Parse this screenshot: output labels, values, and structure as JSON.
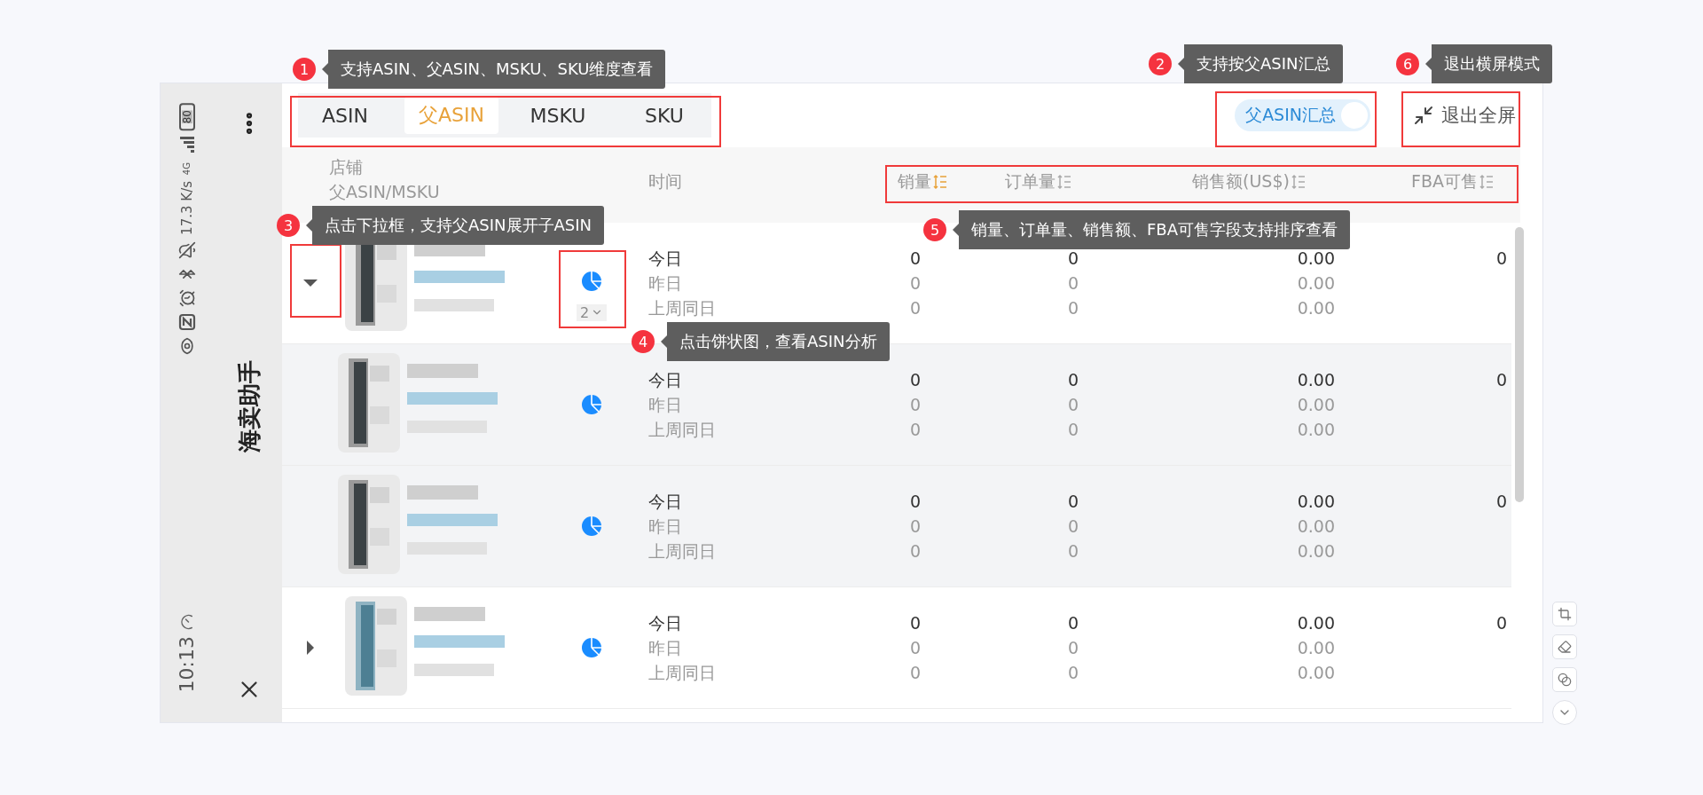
{
  "status_bar": {
    "battery": "80",
    "network": "4G",
    "speed": "17.3 K/s",
    "time": "10:13"
  },
  "app_bar": {
    "title": "海卖助手"
  },
  "tabs": [
    {
      "label": "ASIN",
      "selected": false
    },
    {
      "label": "父ASIN",
      "selected": true
    },
    {
      "label": "MSKU",
      "selected": false
    },
    {
      "label": "SKU",
      "selected": false
    }
  ],
  "summary_toggle": {
    "label": "父ASIN汇总",
    "on": true
  },
  "exit_button": {
    "label": "退出全屏"
  },
  "table": {
    "header": {
      "store": "店铺",
      "item": "父ASIN/MSKU",
      "time": "时间"
    },
    "sort_columns": [
      {
        "label": "销量",
        "selected": true
      },
      {
        "label": "订单量",
        "selected": false
      },
      {
        "label": "销售额(US$)",
        "selected": false
      },
      {
        "label": "FBA可售",
        "selected": false
      }
    ],
    "rows": [
      {
        "expanded": true,
        "child_count": "2",
        "fba": "0",
        "metrics": [
          {
            "period": "今日",
            "sales": "0",
            "orders": "0",
            "revenue": "0.00"
          },
          {
            "period": "昨日",
            "sales": "0",
            "orders": "0",
            "revenue": "0.00"
          },
          {
            "period": "上周同日",
            "sales": "0",
            "orders": "0",
            "revenue": "0.00"
          }
        ],
        "children": [
          {
            "fba": "0",
            "metrics": [
              {
                "period": "今日",
                "sales": "0",
                "orders": "0",
                "revenue": "0.00"
              },
              {
                "period": "昨日",
                "sales": "0",
                "orders": "0",
                "revenue": "0.00"
              },
              {
                "period": "上周同日",
                "sales": "0",
                "orders": "0",
                "revenue": "0.00"
              }
            ]
          },
          {
            "fba": "0",
            "metrics": [
              {
                "period": "今日",
                "sales": "0",
                "orders": "0",
                "revenue": "0.00"
              },
              {
                "period": "昨日",
                "sales": "0",
                "orders": "0",
                "revenue": "0.00"
              },
              {
                "period": "上周同日",
                "sales": "0",
                "orders": "0",
                "revenue": "0.00"
              }
            ]
          }
        ]
      },
      {
        "expanded": false,
        "fba": "0",
        "metrics": [
          {
            "period": "今日",
            "sales": "0",
            "orders": "0",
            "revenue": "0.00"
          },
          {
            "period": "昨日",
            "sales": "0",
            "orders": "0",
            "revenue": "0.00"
          },
          {
            "period": "上周同日",
            "sales": "0",
            "orders": "0",
            "revenue": "0.00"
          }
        ]
      }
    ]
  },
  "annotations": [
    {
      "number": "1",
      "text": "支持ASIN、父ASIN、MSKU、SKU维度查看"
    },
    {
      "number": "2",
      "text": "支持按父ASIN汇总"
    },
    {
      "number": "3",
      "text": "点击下拉框，支持父ASIN展开子ASIN"
    },
    {
      "number": "4",
      "text": "点击饼状图，查看ASIN分析"
    },
    {
      "number": "5",
      "text": "销量、订单量、销售额、FBA可售字段支持排序查看"
    },
    {
      "number": "6",
      "text": "退出横屏模式"
    }
  ]
}
